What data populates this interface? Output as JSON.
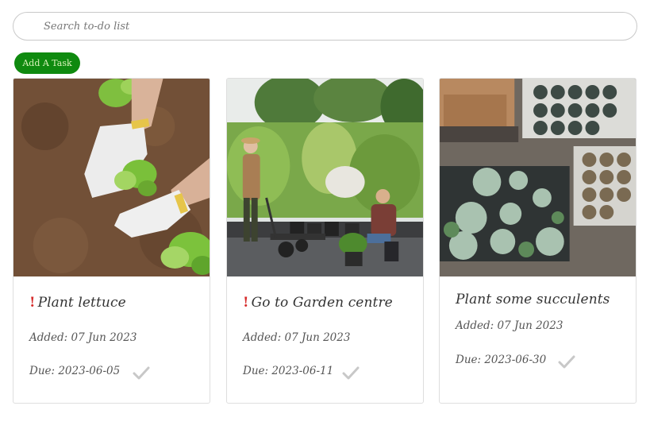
{
  "search": {
    "placeholder": "Search to-do list",
    "value": ""
  },
  "add_task_label": "Add A Task",
  "colors": {
    "accent_green": "#0f8a0f",
    "priority_red": "#d62b2b",
    "check_gray": "#c8c8c8"
  },
  "tasks": [
    {
      "title": "Plant lettuce",
      "priority": true,
      "priority_mark": "!",
      "added": "Added: 07 Jun 2023",
      "due": "Due: 2023-06-05",
      "image": "hands-planting-lettuce-photo"
    },
    {
      "title": "Go to Garden centre",
      "priority": true,
      "priority_mark": "!",
      "added": "Added: 07 Jun 2023",
      "due": "Due: 2023-06-11",
      "image": "garden-centre-plants-photo"
    },
    {
      "title": "Plant some succulents",
      "priority": false,
      "priority_mark": "",
      "added": "Added: 07 Jun 2023",
      "due": "Due: 2023-06-30",
      "image": "succulent-trays-photo"
    }
  ]
}
